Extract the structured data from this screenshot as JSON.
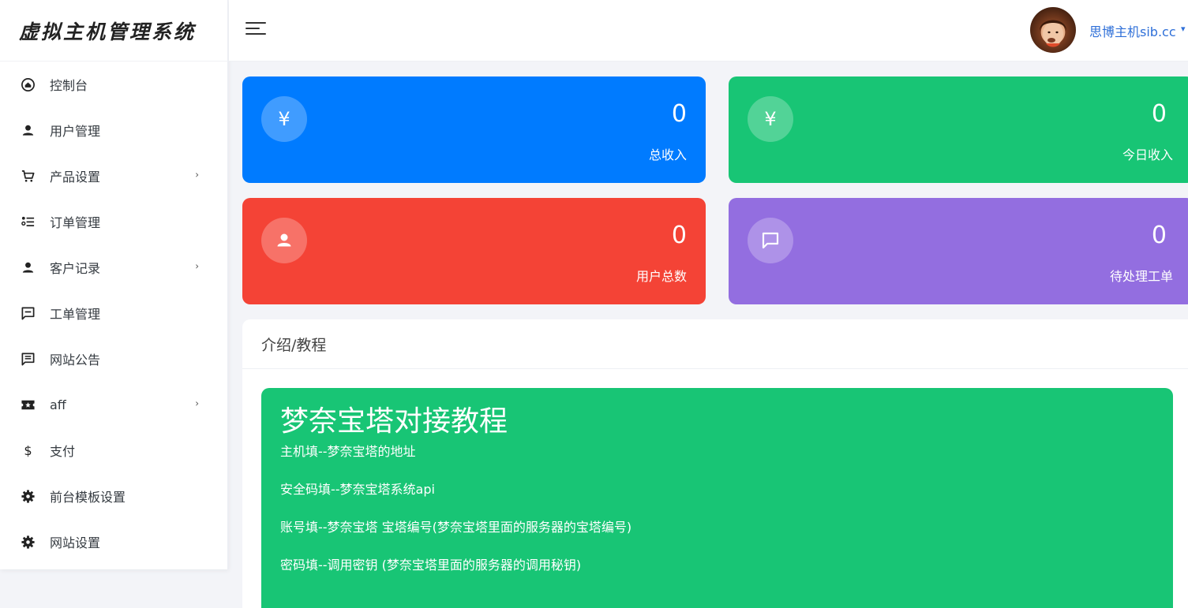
{
  "brand": {
    "title": "虚拟主机管理系统"
  },
  "sidebar": {
    "items": [
      {
        "label": "控制台",
        "icon": "home-icon",
        "has_arrow": false
      },
      {
        "label": "用户管理",
        "icon": "user-icon",
        "has_arrow": false
      },
      {
        "label": "产品设置",
        "icon": "cart-icon",
        "has_arrow": true,
        "arrow": "›"
      },
      {
        "label": "订单管理",
        "icon": "list-icon",
        "has_arrow": false
      },
      {
        "label": "客户记录",
        "icon": "user-icon",
        "has_arrow": true,
        "arrow": "›"
      },
      {
        "label": "工单管理",
        "icon": "ticket-message-icon",
        "has_arrow": false
      },
      {
        "label": "网站公告",
        "icon": "announcement-icon",
        "has_arrow": false
      },
      {
        "label": "aff",
        "icon": "ticket-icon",
        "has_arrow": true,
        "arrow": "›"
      },
      {
        "label": "支付",
        "icon": "dollar-icon",
        "has_arrow": false
      },
      {
        "label": "前台模板设置",
        "icon": "gear-icon",
        "has_arrow": false
      },
      {
        "label": "网站设置",
        "icon": "gear-icon",
        "has_arrow": false
      }
    ]
  },
  "header": {
    "user_name": "思博主机sib.cc",
    "caret": "▾"
  },
  "stats": {
    "total_income": {
      "value": "0",
      "label": "总收入",
      "symbol": "¥",
      "color": "#007bff"
    },
    "today_income": {
      "value": "0",
      "label": "今日收入",
      "symbol": "¥",
      "color": "#18c575"
    },
    "total_users": {
      "value": "0",
      "label": "用户总数",
      "color": "#f44336"
    },
    "pending_tickets": {
      "value": "0",
      "label": "待处理工单",
      "color": "#936ee0"
    }
  },
  "intro": {
    "header": "介绍/教程",
    "tutorial": {
      "title": "梦奈宝塔对接教程",
      "lines": [
        "主机填--梦奈宝塔的地址",
        "安全码填--梦奈宝塔系统api",
        "账号填--梦奈宝塔 宝塔编号(梦奈宝塔里面的服务器的宝塔编号)",
        "密码填--调用密钥 (梦奈宝塔里面的服务器的调用秘钥)"
      ]
    }
  }
}
